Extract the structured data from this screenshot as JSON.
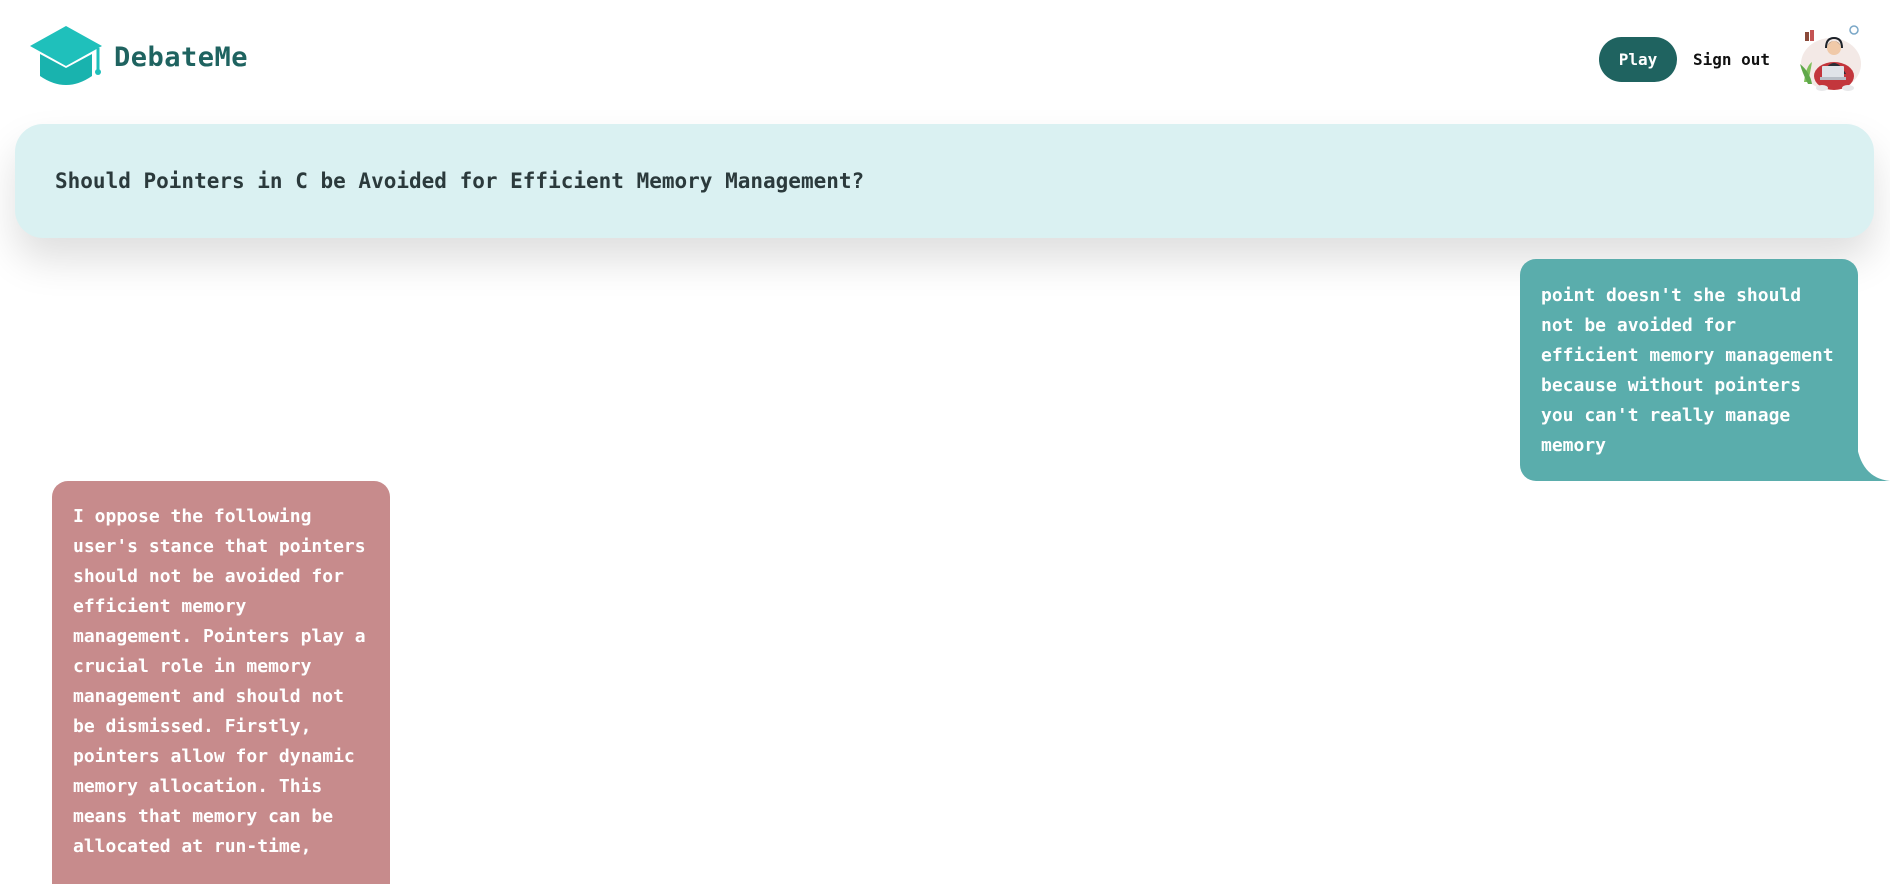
{
  "app": {
    "name": "DebateMe"
  },
  "header": {
    "play_label": "Play",
    "signout_label": "Sign out"
  },
  "topic": {
    "title": "Should Pointers in C be Avoided for Efficient Memory Management?"
  },
  "messages": [
    {
      "role": "user",
      "text": "point doesn't she should not be avoided for efficient memory management because without pointers you can't really manage memory"
    },
    {
      "role": "opponent",
      "text": "I oppose the following user's stance that pointers should not be avoided for efficient memory management. Pointers play a crucial role in memory management and should not be dismissed. Firstly, pointers allow for dynamic memory allocation. This means that memory can be allocated at run-time,"
    }
  ],
  "colors": {
    "brand": "#1f6360",
    "logo": "#1fc0bb",
    "topic_bg": "#daf1f2",
    "user_bubble": "#5aadac",
    "opponent_bubble": "#c78b8c"
  },
  "icons": {
    "logo": "graduation-cap-icon",
    "avatar": "user-avatar"
  }
}
